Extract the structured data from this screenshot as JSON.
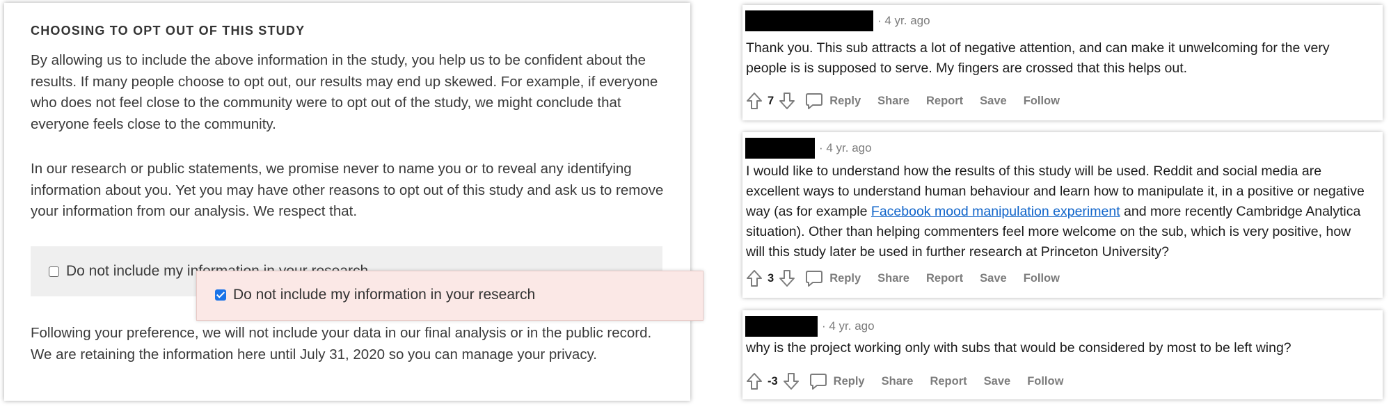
{
  "study": {
    "title": "CHOOSING TO OPT OUT OF THIS STUDY",
    "paragraph1": "By allowing us to include the above information in the study, you help us to be confident about the results. If many people choose to opt out, our results may end up skewed. For example, if everyone who does not feel close to the community were to opt out of the study, we might conclude that everyone feels close to the community.",
    "paragraph2": "In our research or public statements, we promise never to name you or to reveal any identifying information about you. Yet you may have other reasons to opt out of this study and ask us to remove your information from our analysis. We respect that.",
    "optout_label": "Do not include my information in your research",
    "optout_checked": false,
    "popover_label": "Do not include my information in your research",
    "popover_checked": true,
    "paragraph3": "Following your preference, we will not include your data in our final analysis or in the public record. We are retaining the information here until July 31, 2020 so you can manage your privacy."
  },
  "comments": [
    {
      "age": "· 4 yr. ago",
      "text": "Thank you. This sub attracts a lot of negative attention, and can make it unwelcoming for the very people is is supposed to serve. My fingers are crossed that this helps out.",
      "score": "7",
      "actions": [
        "Reply",
        "Share",
        "Report",
        "Save",
        "Follow"
      ]
    },
    {
      "age": "· 4 yr. ago",
      "text_before_link": "I would like to understand how the results of this study will be used. Reddit and social media are excellent ways to understand human behaviour and learn how to manipulate it, in a positive or negative way (as for example ",
      "link_text": "Facebook mood manipulation experiment",
      "text_after_link": " and more recently Cambridge Analytica situation). Other than helping commenters feel more welcome on the sub, which is very positive, how will this study later be used in further research at Princeton University?",
      "score": "3",
      "actions": [
        "Reply",
        "Share",
        "Report",
        "Save",
        "Follow"
      ]
    },
    {
      "age": "· 4 yr. ago",
      "text": "why is the project working only with subs that would be considered by most to be left wing?",
      "score": "-3",
      "actions": [
        "Reply",
        "Share",
        "Report",
        "Save",
        "Follow"
      ]
    }
  ],
  "icons": {
    "upvote": "upvote-arrow-icon",
    "downvote": "downvote-arrow-icon",
    "reply": "comment-bubble-icon"
  },
  "colors": {
    "link": "#0e63c9",
    "checkbox_checked": "#1a73e8",
    "popover_bg": "#fbe8e6",
    "optout_bg": "#efefef"
  }
}
